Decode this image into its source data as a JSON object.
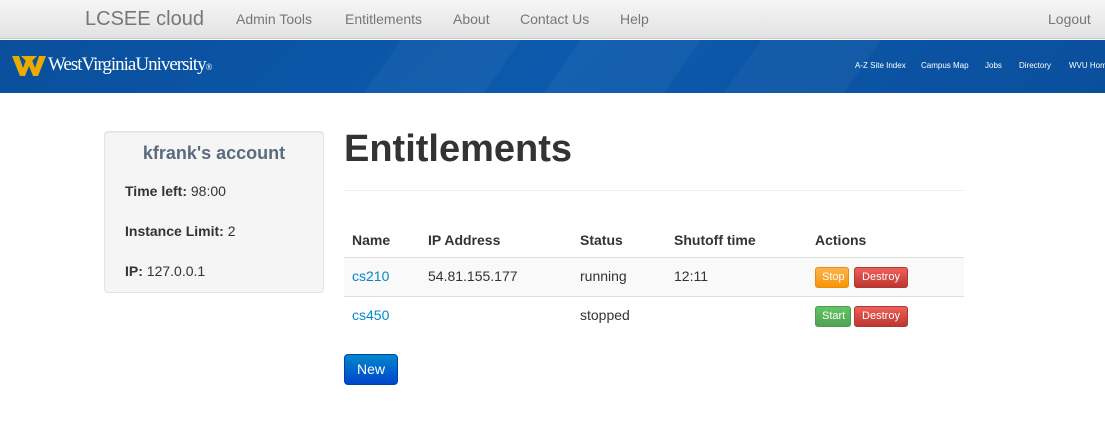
{
  "navbar": {
    "brand": "LCSEE cloud",
    "items": [
      "Admin Tools",
      "Entitlements",
      "About",
      "Contact Us",
      "Help"
    ],
    "logout": "Logout"
  },
  "banner": {
    "university_name": "WestVirginiaUniversity",
    "registered_mark": "®",
    "links": [
      "A-Z Site Index",
      "Campus Map",
      "Jobs",
      "Directory",
      "WVU Hom"
    ]
  },
  "account": {
    "title": "kfrank's account",
    "time_left_label": "Time left:",
    "time_left_value": "98:00",
    "instance_limit_label": "Instance Limit:",
    "instance_limit_value": "2",
    "ip_label": "IP:",
    "ip_value": "127.0.0.1"
  },
  "main": {
    "title": "Entitlements",
    "columns": [
      "Name",
      "IP Address",
      "Status",
      "Shutoff time",
      "Actions"
    ],
    "rows": [
      {
        "name": "cs210",
        "ip": "54.81.155.177",
        "status": "running",
        "shutoff": "12:11",
        "actions": [
          "Stop",
          "Destroy"
        ]
      },
      {
        "name": "cs450",
        "ip": "",
        "status": "stopped",
        "shutoff": "",
        "actions": [
          "Start",
          "Destroy"
        ]
      }
    ],
    "new_button": "New"
  },
  "colors": {
    "link": "#0088cc",
    "banner_blue": "#0c5aad",
    "wvu_gold": "#eaaa00",
    "stop_orange": "#f89406",
    "destroy_red": "#bd362f",
    "start_green": "#51a351",
    "new_blue": "#0044cc"
  }
}
